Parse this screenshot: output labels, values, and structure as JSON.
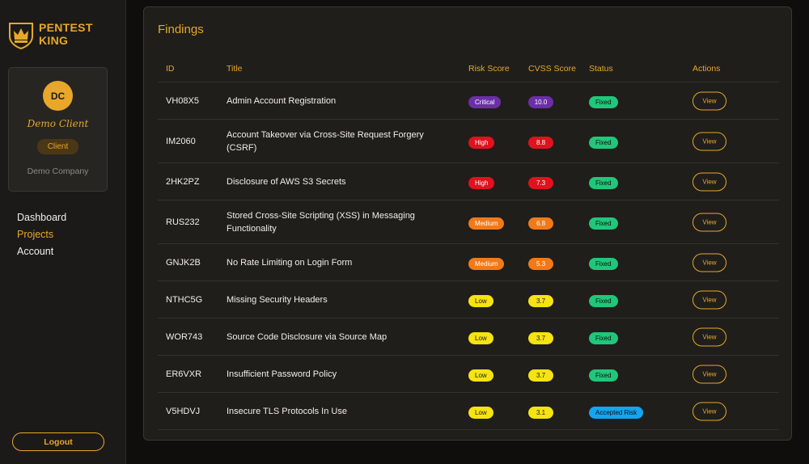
{
  "brand": {
    "line1": "PENTEST",
    "line2": "KING",
    "logo_icon": "crown-shield-icon"
  },
  "client": {
    "initials": "DC",
    "name": "Demo Client",
    "role": "Client",
    "company": "Demo Company"
  },
  "nav": [
    {
      "label": "Dashboard",
      "active": false
    },
    {
      "label": "Projects",
      "active": true
    },
    {
      "label": "Account",
      "active": false
    }
  ],
  "logout_label": "Logout",
  "findings": {
    "title": "Findings",
    "columns": {
      "id": "ID",
      "title": "Title",
      "risk": "Risk Score",
      "cvss": "CVSS Score",
      "status": "Status",
      "actions": "Actions"
    },
    "view_label": "View",
    "rows": [
      {
        "id": "VH08X5",
        "title": "Admin Account Registration",
        "risk": "Critical",
        "cvss": "10.0",
        "status": "Fixed"
      },
      {
        "id": "IM2060",
        "title": "Account Takeover via Cross-Site Request Forgery (CSRF)",
        "risk": "High",
        "cvss": "8.8",
        "status": "Fixed"
      },
      {
        "id": "2HK2PZ",
        "title": "Disclosure of AWS S3 Secrets",
        "risk": "High",
        "cvss": "7.3",
        "status": "Fixed"
      },
      {
        "id": "RUS232",
        "title": "Stored Cross-Site Scripting (XSS) in Messaging Functionality",
        "risk": "Medium",
        "cvss": "6.8",
        "status": "Fixed"
      },
      {
        "id": "GNJK2B",
        "title": "No Rate Limiting on Login Form",
        "risk": "Medium",
        "cvss": "5.3",
        "status": "Fixed"
      },
      {
        "id": "NTHC5G",
        "title": "Missing Security Headers",
        "risk": "Low",
        "cvss": "3.7",
        "status": "Fixed"
      },
      {
        "id": "WOR743",
        "title": "Source Code Disclosure via Source Map",
        "risk": "Low",
        "cvss": "3.7",
        "status": "Fixed"
      },
      {
        "id": "ER6VXR",
        "title": "Insufficient Password Policy",
        "risk": "Low",
        "cvss": "3.7",
        "status": "Fixed"
      },
      {
        "id": "V5HDVJ",
        "title": "Insecure TLS Protocols In Use",
        "risk": "Low",
        "cvss": "3.1",
        "status": "Accepted Risk"
      }
    ]
  },
  "colors": {
    "accent": "#e8a72a",
    "critical": "#6b2fa8",
    "high": "#e0121e",
    "medium": "#f07a1a",
    "low": "#f5e312",
    "fixed": "#1fc77a",
    "accepted_risk": "#13a6f0"
  }
}
